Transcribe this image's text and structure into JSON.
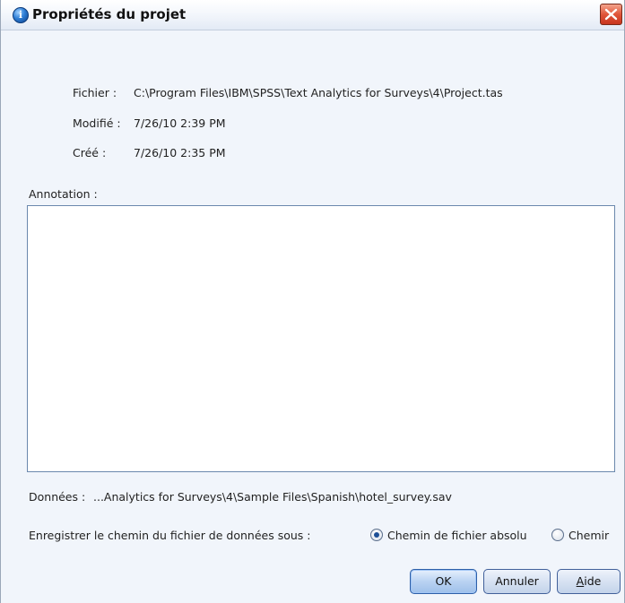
{
  "window": {
    "title": "Propriétés du projet",
    "title_icon": "info-project-icon",
    "close_icon": "close-icon"
  },
  "info": {
    "file_label": "Fichier :",
    "file_value": "C:\\Program Files\\IBM\\SPSS\\Text Analytics for Surveys\\4\\Project.tas",
    "modified_label": "Modifié :",
    "modified_value": "7/26/10 2:39 PM",
    "created_label": "Créé :",
    "created_value": "7/26/10 2:35 PM"
  },
  "annotation": {
    "label": "Annotation :",
    "value": ""
  },
  "data": {
    "label": "Données :",
    "value": "...Analytics for Surveys\\4\\Sample Files\\Spanish\\hotel_survey.sav"
  },
  "save_path": {
    "label": "Enregistrer le chemin du fichier de données sous :",
    "options": [
      {
        "label": "Chemin de fichier absolu",
        "checked": true
      },
      {
        "label": "Chemir",
        "checked": false
      }
    ]
  },
  "buttons": {
    "ok": "OK",
    "cancel": "Annuler",
    "help_mnemonic": "A",
    "help_rest": "ide"
  },
  "colors": {
    "titlebar": "#e3eaf5",
    "dialog_bg": "#f1f5fb",
    "close": "#d9492d",
    "button_border": "#41609a"
  }
}
